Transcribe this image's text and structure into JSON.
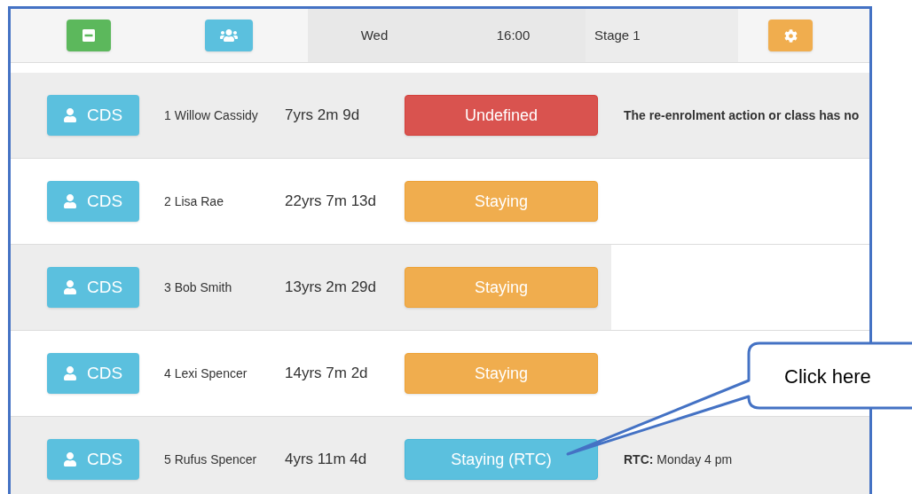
{
  "header": {
    "day": "Wed",
    "time": "16:00",
    "stage": "Stage 1"
  },
  "students": [
    {
      "button": "CDS",
      "name": "1 Willow Cassidy",
      "age": "7yrs 2m 9d",
      "status": {
        "text": "Undefined",
        "kind": "danger"
      },
      "note": {
        "text": "The re-enrolment action or class has no",
        "kind": "warning"
      }
    },
    {
      "button": "CDS",
      "name": "2 Lisa Rae",
      "age": "22yrs 7m 13d",
      "status": {
        "text": "Staying",
        "kind": "warning"
      }
    },
    {
      "button": "CDS",
      "name": "3 Bob Smith",
      "age": "13yrs 2m 29d",
      "status": {
        "text": "Staying",
        "kind": "warning"
      }
    },
    {
      "button": "CDS",
      "name": "4 Lexi Spencer",
      "age": "14yrs 7m 2d",
      "status": {
        "text": "Staying",
        "kind": "warning"
      }
    },
    {
      "button": "CDS",
      "name": "5 Rufus Spencer",
      "age": "4yrs 11m 4d",
      "status": {
        "text": "Staying (RTC)",
        "kind": "info"
      },
      "note": {
        "text": "**RTC:** Monday 4 pm",
        "kind": "info"
      }
    }
  ],
  "callout": {
    "text": "Click here"
  }
}
